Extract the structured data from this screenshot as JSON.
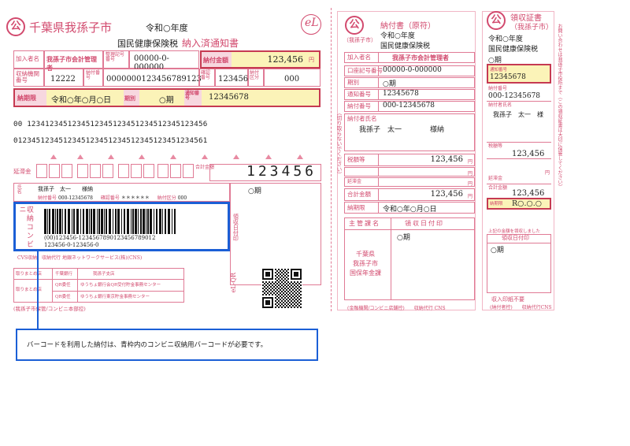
{
  "city": "千葉県我孫子市",
  "era_year": "令和○年度",
  "tax_name": "国民健康保険税",
  "notice_title": "納入済通知書",
  "el_logo": "eL",
  "kanyusha_label": "加入者名",
  "kanyusha": "我孫子市会計管理者",
  "seiri_label": "整理記号番号",
  "seiri": "00000-0-000000",
  "nofu_kingaku_label": "納付金額",
  "amount": "123,456",
  "yen": "円",
  "shuno_label": "収納機関番号",
  "shuno": "12222",
  "nofu_bango_label": "納付番号",
  "nofu_bango": "0000000123456789123",
  "kakunin_label": "確認番号",
  "kakunin": "123456",
  "nofu_kubun_label": "納付区分",
  "nofu_kubun": "000",
  "kigen_label": "納期限",
  "kigen": "令和○年○月○日",
  "kibetsu_label": "期別",
  "kibetsu": "○期",
  "tsuchi_label": "通知番号",
  "tsuchi": "12345678",
  "ocr1": "00 1234123451234512345123451234512345123456",
  "ocr2": "0123451234512345123451234512345123451234561",
  "enkin_label": "延滞金",
  "gokei_label": "合計金額",
  "gokei_digits": "123456",
  "shimei_label": "氏名",
  "shimei": "我孫子　太一　　様納",
  "small_nofu_label": "納付番号",
  "small_nofu": "000-12345678",
  "small_kakunin_label": "確認番号",
  "small_kakunin": "＊＊＊＊＊＊",
  "small_kubun_label": "納付区分",
  "small_kubun": "000",
  "kibetsu2": "○期",
  "kibetsu3": "○期",
  "barcode_side": "収納コンビニ",
  "barcode_line1": "(00)123456-1234567890123456789012",
  "barcode_line2": "123456-0-123456-0",
  "cvs_label": "CVS収納　収納代行 地銀ネットワークサービス(株)(CNS)",
  "ryoshu_stamp": "領収日付印",
  "bank1_label": "取りまとめ店",
  "bank1_mid": "千葉銀行",
  "bank1": "我孫子支店",
  "bank2_label": "取りまとめ店",
  "bank2_mid": "QR委任",
  "bank2": "ゆうちょ銀行会QR受付貯金事務センター",
  "bank3_mid": "QR委任",
  "bank3": "ゆうちょ銀行東京貯金事務センター",
  "footer_left": "(我孫子市保管/コンビニ本部控)",
  "eqr": "eL-QR",
  "note": "バーコードを利用した納付は、青枠内のコンビニ収納用バーコードが必要です。",
  "mid_title": "納付書（原符）",
  "mid_city": "（我孫子市）",
  "mid_era": "令和○年度",
  "mid_tax": "国民健康保険税",
  "mid_kanyu_label": "加入者名",
  "mid_kanyu": "我孫子市会計管理者",
  "mid_koza_label": "口座記号番号",
  "mid_koza": "00000-0-000000",
  "mid_kibetsu_label": "期別",
  "mid_kibetsu": "○期",
  "mid_tsuchi_label": "通知番号",
  "mid_tsuchi": "12345678",
  "mid_nofu_label": "納付番号",
  "mid_nofu": "000-12345678",
  "mid_nofusha_label": "納付者氏名",
  "mid_nofusha": "我孫子　太一　　　　様納",
  "mid_zeigaku_label": "税額等",
  "mid_zeigaku": "123,456",
  "mid_enkin_label": "延滞金",
  "mid_gokei_label": "合計金額",
  "mid_gokei": "123,456",
  "mid_kigen_label": "納期限",
  "mid_kigen": "令和○年○月○日",
  "mid_shukan_label": "主管課名",
  "mid_ryoshu_label": "領収日付印",
  "mid_kibetsu2": "○期",
  "mid_shukan": "千葉県\n我孫子市\n国保年金課",
  "mid_footer": "(金融機関/コンビニ店舗控)　　収納代行 CNS",
  "mid_side": "（切り取らないでください）",
  "r_title": "領収証書",
  "r_city": "（我孫子市）",
  "r_era": "令和○年度",
  "r_tax": "国民健康保険税",
  "r_kibetsu": "○期",
  "r_tsuchi_label": "通知番号",
  "r_tsuchi": "12345678",
  "r_nofu_label": "納付番号",
  "r_nofu": "000-12345678",
  "r_nofusha_label": "納付者氏名",
  "r_nofusha": "我孫子　太一　様",
  "r_zei_label": "税額等",
  "r_zei": "123,456",
  "r_enkin_label": "延滞金",
  "r_gokei_label": "合計金額",
  "r_gokei": "123,456",
  "r_kigen_label": "納期限",
  "r_kigen": "R○.○.○",
  "r_receipt_note": "上記の金額を領収しました",
  "r_ryoshu_label": "領収日付印",
  "r_kibetsu2": "○期",
  "r_inshi": "収入印紙不要",
  "r_footer": "(納付者控)　　収納代行CNS",
  "r_side": "お問い合わせは我孫子市役所まで（この領収証書は大切に保管してください）"
}
